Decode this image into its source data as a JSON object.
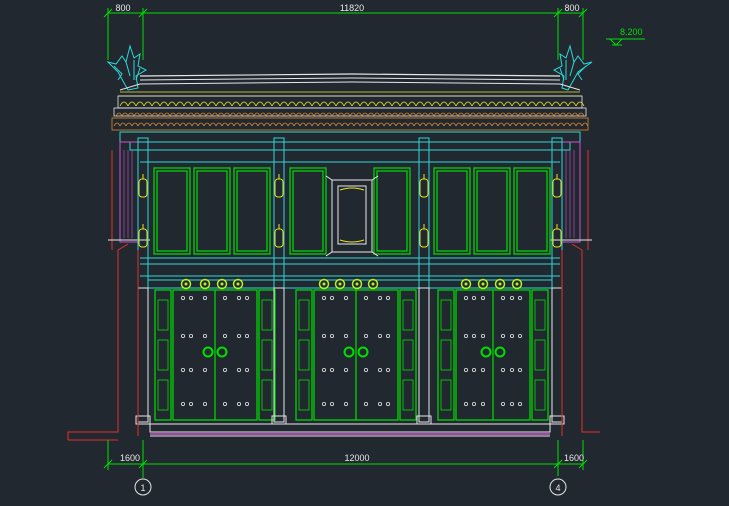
{
  "drawing": {
    "dims_top": [
      "800",
      "11820",
      "800"
    ],
    "dims_bottom": [
      "1600",
      "12000",
      "1600"
    ],
    "elevation": "8.200",
    "axes": [
      "1",
      "4"
    ]
  },
  "colors": {
    "background": "#212830",
    "line_white": "#e6e6e6",
    "line_green": "#00e000",
    "line_cyan": "#2fd7d7",
    "line_red": "#e53030",
    "line_yellow": "#f0e020",
    "line_magenta": "#d050d0",
    "line_orange": "#e08a2a"
  }
}
